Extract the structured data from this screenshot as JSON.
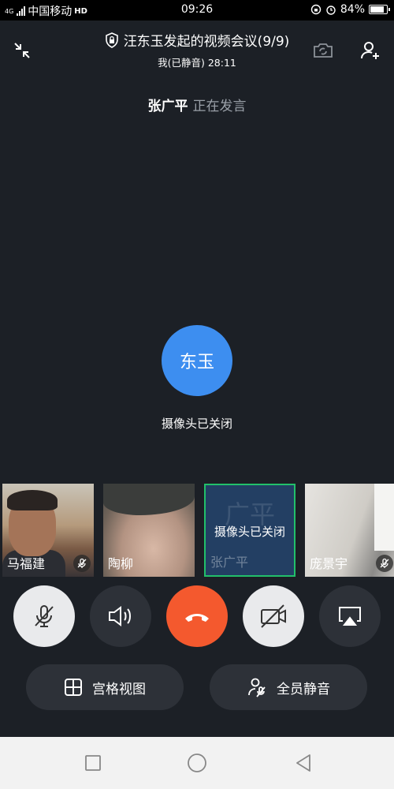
{
  "status_bar": {
    "network": "4G",
    "carrier": "中国移动",
    "time": "09:26",
    "battery": "84%",
    "battery_level": 0.84
  },
  "header": {
    "title": "汪东玉发起的视频会议(9/9)",
    "subtitle": "我(已静音) 28:11"
  },
  "speaker": {
    "name": "张广平",
    "status": "正在发言"
  },
  "main": {
    "avatar_text": "东玉",
    "avatar_color": "#3d8ef0",
    "camera_off_text": "摄像头已关闭"
  },
  "thumbnails": [
    {
      "name": "马福建",
      "muted": true
    },
    {
      "name": "陶柳",
      "muted": false
    },
    {
      "name": "张广平",
      "muted": false,
      "camera_off_text": "摄像头已关闭",
      "bg_text": "广平",
      "active": true
    },
    {
      "name": "庞景宇",
      "muted": true
    }
  ],
  "controls": {
    "mic_icon": "mic-off-icon",
    "speaker_icon": "speaker-icon",
    "end_icon": "hang-up-icon",
    "camera_icon": "camera-off-icon",
    "cast_icon": "screen-cast-icon",
    "end_color": "#f4592e"
  },
  "actions": {
    "grid_view": "宫格视图",
    "mute_all": "全员静音"
  },
  "colors": {
    "background": "#1c2026",
    "active_border": "#22c06a"
  }
}
